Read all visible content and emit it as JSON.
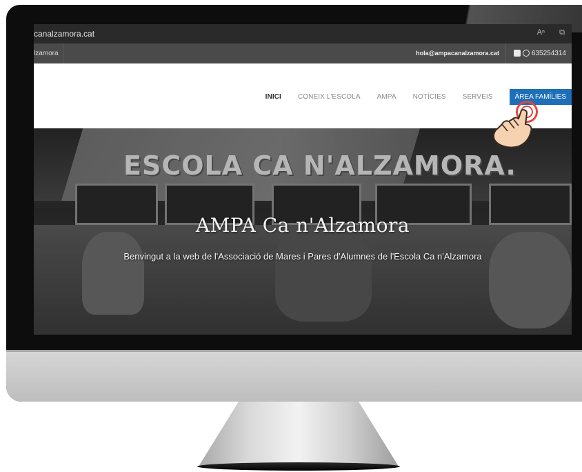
{
  "browser": {
    "url": "canalzamora.cat",
    "icons": [
      "text-size-icon",
      "reader-icon"
    ],
    "icon_glyphs": [
      "Aⁿ",
      "⧉"
    ]
  },
  "topbar": {
    "brand": "lzamora",
    "email": "hola@ampacanalzamora.cat",
    "phone": "635254314"
  },
  "nav": {
    "items": [
      "INICI",
      "CONEIX L'ESCOLA",
      "AMPA",
      "NOTÍCIES",
      "SERVEIS"
    ],
    "active_index": 0,
    "cta": "ÀREA FAMÍLIES"
  },
  "hero": {
    "sign": "ESCOLA CA N'ALZAMORA.",
    "title": "AMPA Ca n'Alzamora",
    "subtitle": "Benvingut a la web de l'Associació de Mares i Pares d'Alumnes de l'Escola Ca n'Alzamora"
  },
  "colors": {
    "cta_bg": "#1d6fb8",
    "tap_ring": "#e0473f"
  }
}
